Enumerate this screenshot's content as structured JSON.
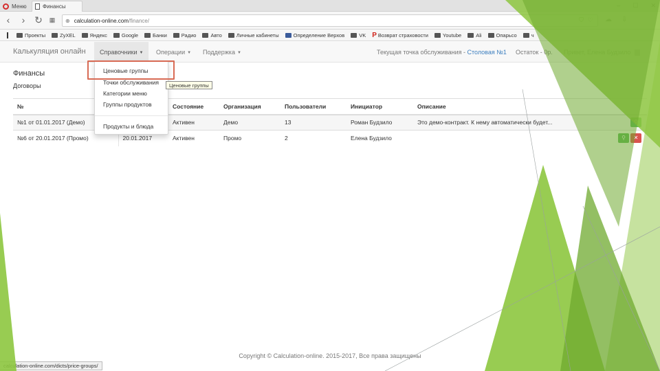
{
  "browser": {
    "menu_tab": "Меню",
    "active_tab": "Финансы",
    "url_host": "calculation-online.com",
    "url_path": "/finance/",
    "window_controls": [
      "–",
      "☐",
      "✕"
    ],
    "bookmarks": [
      "Проекты",
      "ZyXEL",
      "Яндекс",
      "Google",
      "Банки",
      "Радио",
      "Авто",
      "Личные кабинеты",
      "Определение Верхов",
      "VK",
      "Возврат страховости",
      "Youtube",
      "Ali",
      "Опарьсо",
      "ч"
    ]
  },
  "navbar": {
    "brand": "Калькуляция онлайн",
    "menu_directories": "Справочники",
    "menu_operations": "Операции",
    "menu_support": "Поддержка",
    "service_point_label": "Текущая точка обслуживания - ",
    "service_point_value": "Столовая №1",
    "balance": "Остаток - 0р.",
    "greeting": "Привет, Елена Будзило"
  },
  "dropdown": {
    "items": [
      "Ценовые группы",
      "Точки обслуживания",
      "Категории меню",
      "Группы продуктов",
      "Продукты и блюда"
    ],
    "tooltip": "Ценовые группы"
  },
  "main": {
    "title": "Финансы",
    "subtitle": "Договоры",
    "columns": [
      "№",
      "",
      "Состояние",
      "Организация",
      "Пользователи",
      "Инициатор",
      "Описание"
    ],
    "rows": [
      {
        "number": "№1 от 01.01.2017 (Демо)",
        "date": "",
        "status": "Активен",
        "org": "Демо",
        "users": "13",
        "initiator": "Роман Будзило",
        "description": "Это демо-контракт. К нему автоматически будет..."
      },
      {
        "number": "№6 от 20.01.2017 (Промо)",
        "date": "20.01.2017",
        "status": "Активен",
        "org": "Промо",
        "users": "2",
        "initiator": "Елена Будзило",
        "description": ""
      }
    ]
  },
  "footer": {
    "copyright": "Copyright © Calculation-online. 2015-2017, Все права защищены",
    "status_url": "calculation-online.com/dicts/price-groups/"
  },
  "colors": {
    "accent": "#3d7fbf",
    "highlight": "#d86a54",
    "deco_green": "#8dc63f",
    "success": "#5cb85c"
  }
}
